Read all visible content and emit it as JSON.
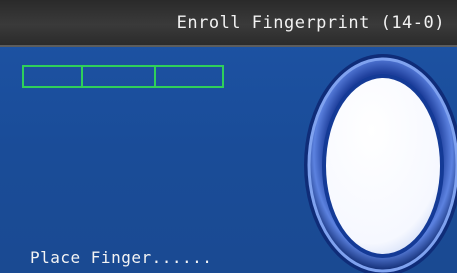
{
  "header": {
    "title": "Enroll Fingerprint (14-0)"
  },
  "enroll_progress": {
    "steps_total": 3,
    "steps_completed": 0,
    "border_color": "#2fd05a"
  },
  "fingerprint_sensor": {
    "icon": "fingerprint-scan-area-icon",
    "ring_color": "#3c63c8",
    "fill_color": "#ffffff"
  },
  "status": {
    "prompt": "Place Finger......"
  },
  "colors": {
    "background": "#1b4f9e",
    "titlebar": "#333333",
    "text": "#f2f2f2"
  }
}
